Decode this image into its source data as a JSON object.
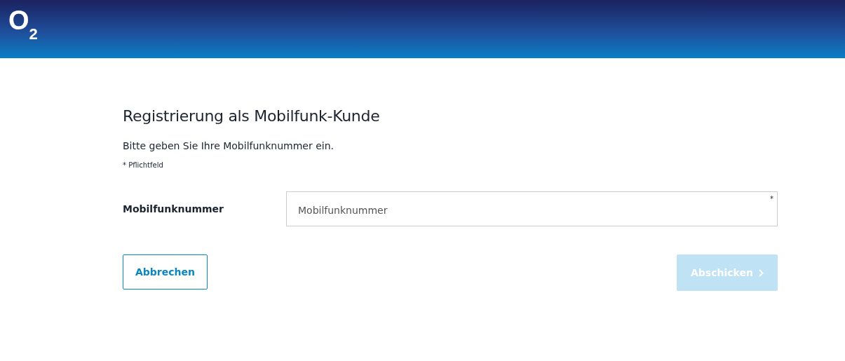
{
  "header": {
    "logo": "O$_{2}$"
  },
  "form": {
    "title": "Registrierung als Mobilfunk-Kunde",
    "intro": "Bitte geben Sie Ihre Mobilfunknummer ein.",
    "required_note": "* Pflichtfeld",
    "field": {
      "label": "Mobilfunknummer",
      "placeholder": "Mobilfunknummer",
      "required_mark": "*"
    },
    "buttons": [
      {
        "kind": "secondary",
        "label": "Abbrechen",
        "disabled": false
      },
      {
        "kind": "primary",
        "label": "Abschicken",
        "disabled": true
      }
    ]
  }
}
